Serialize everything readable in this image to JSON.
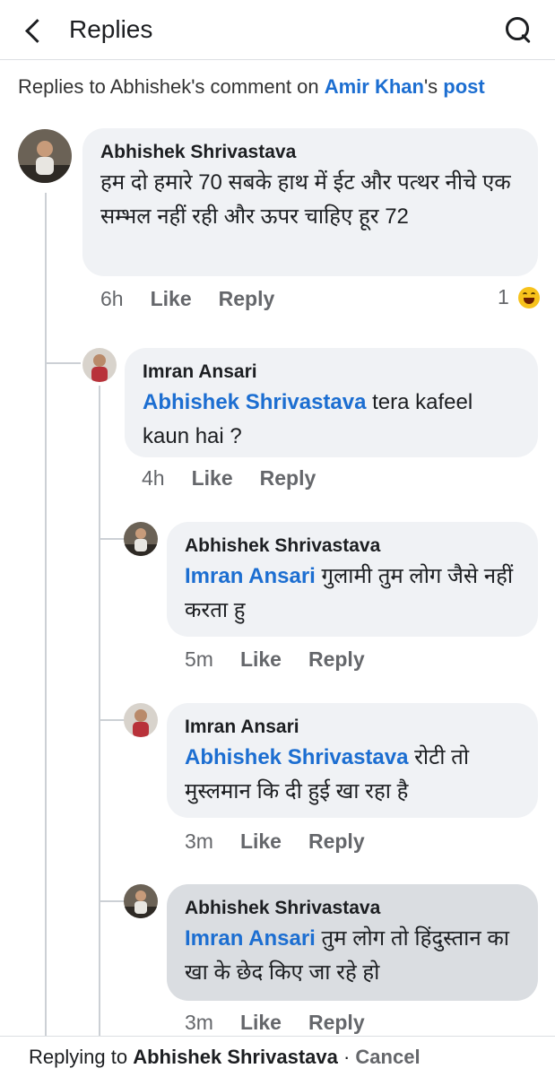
{
  "header": {
    "title": "Replies"
  },
  "context": {
    "prefix": "Replies to Abhishek's comment on ",
    "page_name": "Amir Khan",
    "possessive": "'s ",
    "post_link": "post"
  },
  "comments": [
    {
      "author": "Abhishek Shrivastava",
      "mention": "",
      "text": "हम दो हमारे 70 सबके हाथ में ईट और पत्थर नीचे एक सम्भल नहीं रही और ऊपर चाहिए हूर 72",
      "time": "6h",
      "like": "Like",
      "reply": "Reply",
      "reaction_count": "1",
      "reaction_icon": "haha-icon"
    },
    {
      "author": "Imran Ansari",
      "mention": "Abhishek Shrivastava",
      "text": " tera kafeel kaun hai ?",
      "time": "4h",
      "like": "Like",
      "reply": "Reply"
    },
    {
      "author": "Abhishek Shrivastava",
      "mention": "Imran Ansari",
      "text": " गुलामी तुम लोग जैसे नहीं करता हु",
      "time": "5m",
      "like": "Like",
      "reply": "Reply"
    },
    {
      "author": "Imran Ansari",
      "mention": "Abhishek Shrivastava",
      "text": " रोटी तो मुस्लमान कि दी हुई खा रहा है",
      "time": "3m",
      "like": "Like",
      "reply": "Reply"
    },
    {
      "author": "Abhishek Shrivastava",
      "mention": "Imran Ansari",
      "text": " तुम लोग तो हिंदुस्तान का खा के छेद किए जा रहे हो",
      "time": "3m",
      "like": "Like",
      "reply": "Reply"
    }
  ],
  "footer": {
    "prefix": "Replying to ",
    "target": "Abhishek Shrivastava",
    "separator": " · ",
    "cancel": "Cancel"
  },
  "colors": {
    "link": "#1c6ed1",
    "bubble": "#f0f2f5",
    "bubble_highlight": "#dadde1",
    "meta": "#65676b"
  }
}
